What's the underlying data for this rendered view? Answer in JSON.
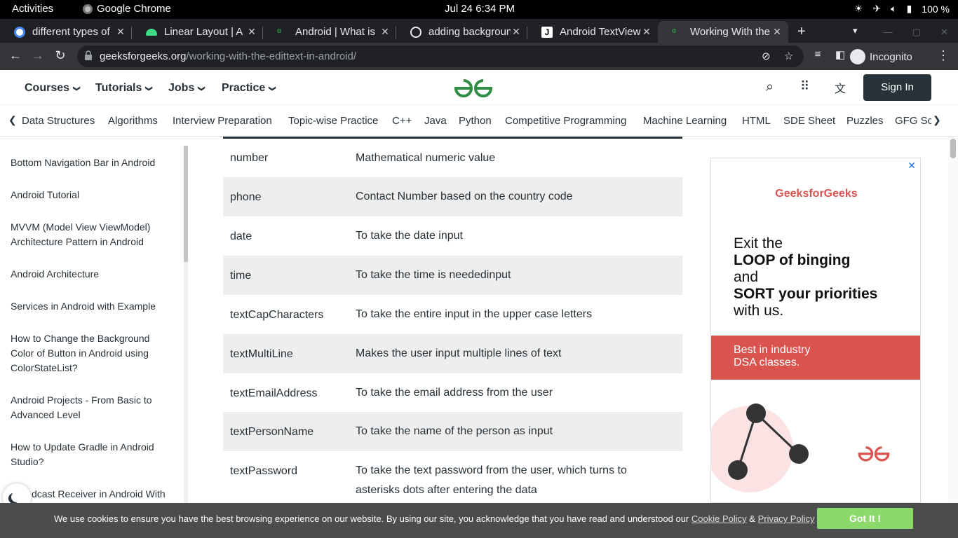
{
  "os": {
    "activities": "Activities",
    "app": "Google Chrome",
    "clock": "Jul 24   6:34 PM",
    "battery": "100 %"
  },
  "tabs": [
    {
      "title": "different types of",
      "icon": "google-icon",
      "color": "#4285f4"
    },
    {
      "title": "Linear Layout | A",
      "icon": "android-icon",
      "color": "#3ddc84"
    },
    {
      "title": "Android | What is",
      "icon": "gfg-icon",
      "color": "#2f8d46"
    },
    {
      "title": "adding backgroun",
      "icon": "globe-icon",
      "color": "#e8eaed"
    },
    {
      "title": "Android TextView",
      "icon": "j-icon",
      "color": "#ffffff"
    },
    {
      "title": "Working With the",
      "icon": "gfg-icon",
      "color": "#2f8d46"
    }
  ],
  "omnibox": {
    "domain": "geeksforgeeks.org",
    "path": "/working-with-the-edittext-in-android/",
    "incognito": "Incognito"
  },
  "header": {
    "menu": [
      "Courses",
      "Tutorials",
      "Jobs",
      "Practice"
    ],
    "signin": "Sign In"
  },
  "subnav": [
    "Data Structures",
    "Algorithms",
    "Interview Preparation",
    "Topic-wise Practice",
    "C++",
    "Java",
    "Python",
    "Competitive Programming",
    "Machine Learning",
    "HTML",
    "SDE Sheet",
    "Puzzles",
    "GFG Sch"
  ],
  "sidebar": [
    "Bottom Navigation Bar in Android",
    "Android Tutorial",
    "MVVM (Model View ViewModel) Architecture Pattern in Android",
    "Android Architecture",
    "Services in Android with Example",
    "How to Change the Background Color of Button in Android using ColorStateList?",
    "Android Projects - From Basic to Advanced Level",
    "How to Update Gradle in Android Studio?",
    "dcast Receiver in Android With"
  ],
  "table": [
    {
      "type": "number",
      "desc": "Mathematical numeric value"
    },
    {
      "type": "phone",
      "desc": "Contact Number based on the country code"
    },
    {
      "type": "date",
      "desc": "To take the date input"
    },
    {
      "type": "time",
      "desc": "To take the time is neededinput"
    },
    {
      "type": "textCapCharacters",
      "desc": "To take the entire input in the upper case letters"
    },
    {
      "type": "textMultiLine",
      "desc": "Makes the user input multiple lines of text"
    },
    {
      "type": "textEmailAddress",
      "desc": "To take the email address from the user"
    },
    {
      "type": "textPersonName",
      "desc": "To take the name of the person as input"
    },
    {
      "type": "textPassword",
      "desc": "To take the text password from the user, which turns to asterisks dots after entering the data"
    }
  ],
  "ad": {
    "brand": "GeeksforGeeks",
    "line1": "Exit the",
    "line2": "LOOP of binging",
    "line3": "and",
    "line4": "SORT your priorities",
    "line5": "with us.",
    "banner1": "Best in industry",
    "banner2": "DSA classes."
  },
  "cookie": {
    "text": "We use cookies to ensure you have the best browsing experience on our website. By using our site, you acknowledge that you have read and understood our ",
    "cookie_policy": "Cookie Policy",
    "amp": " & ",
    "privacy_policy": "Privacy Policy",
    "button": "Got It !"
  },
  "colors": {
    "brand_green": "#2f8d46",
    "dark": "#273239",
    "ad_red": "#d9534f",
    "cookie_btn": "#8cd96b"
  }
}
